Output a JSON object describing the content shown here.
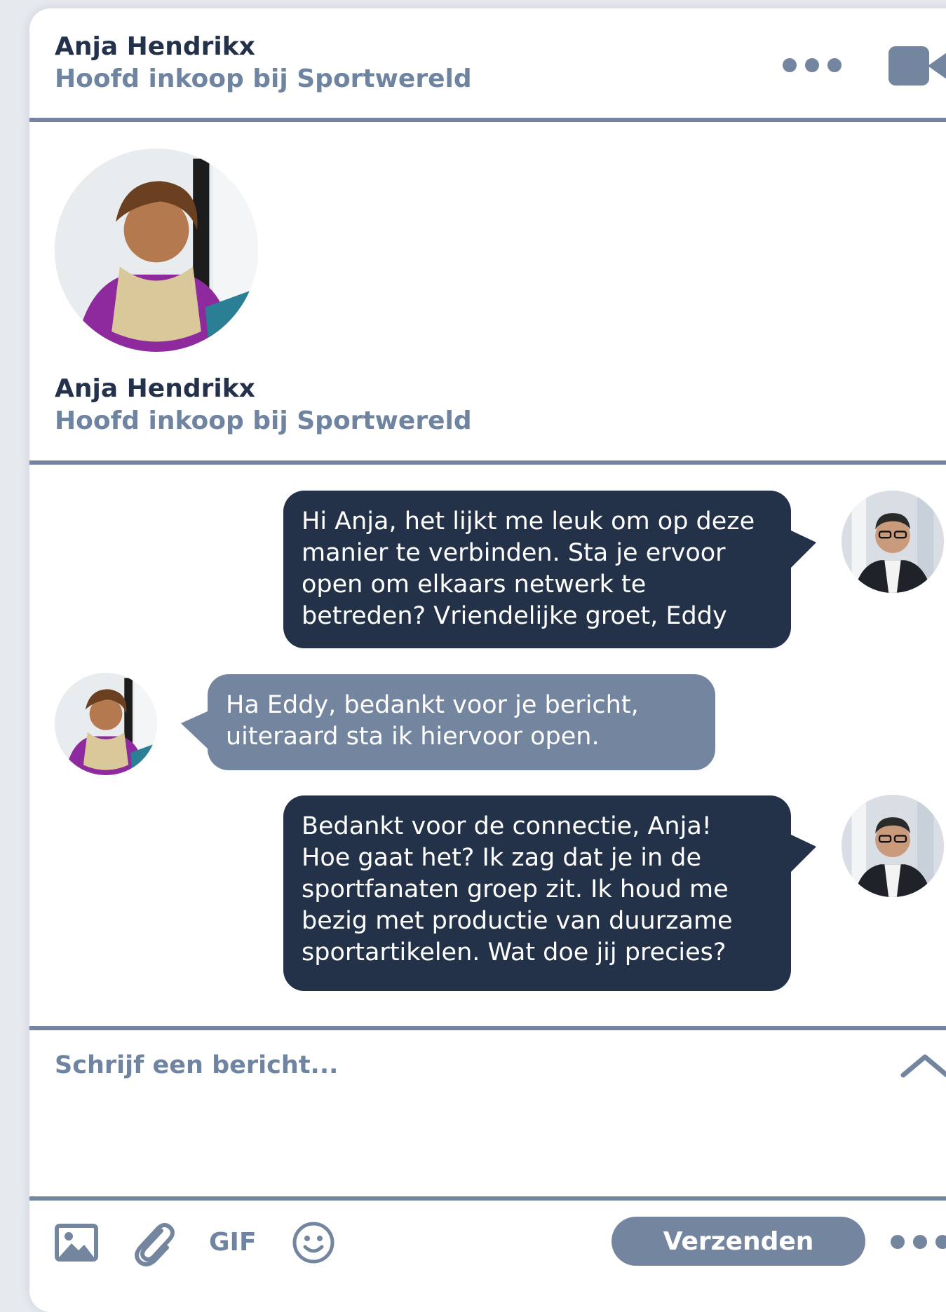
{
  "header": {
    "contact_name": "Anja Hendrikx",
    "contact_role": "Hoofd inkoop bij Sportwereld",
    "more_icon": "more-horizontal-icon",
    "video_icon": "video-camera-icon"
  },
  "profile": {
    "name": "Anja Hendrikx",
    "role": "Hoofd inkoop bij Sportwereld"
  },
  "messages": [
    {
      "direction": "outgoing",
      "lines": [
        "Hi Anja, het lijkt me leuk om op deze",
        "manier te verbinden. Sta je ervoor",
        "open om elkaars netwerk te",
        "betreden? Vriendelijke groet, Eddy"
      ]
    },
    {
      "direction": "incoming",
      "lines": [
        "Ha Eddy, bedankt voor je bericht,",
        "uiteraard sta ik hiervoor open."
      ]
    },
    {
      "direction": "outgoing",
      "lines": [
        "Bedankt voor de connectie, Anja!",
        "Hoe gaat het? Ik zag dat je in de",
        "sportfanaten groep zit. Ik houd me",
        "bezig met productie van duurzame",
        "sportartikelen. Wat doe jij precies?"
      ]
    }
  ],
  "composer": {
    "placeholder": "Schrijf een bericht...",
    "expand_icon": "chevron-up-icon"
  },
  "toolbar": {
    "image_icon": "image-icon",
    "attach_icon": "paperclip-icon",
    "gif_label": "GIF",
    "emoji_icon": "smiley-icon",
    "send_label": "Verzenden",
    "more_icon": "more-horizontal-icon"
  },
  "colors": {
    "dark_bubble": "#233249",
    "light_bubble": "#74869f",
    "name_text": "#23324a",
    "muted_text": "#6f84a1"
  }
}
